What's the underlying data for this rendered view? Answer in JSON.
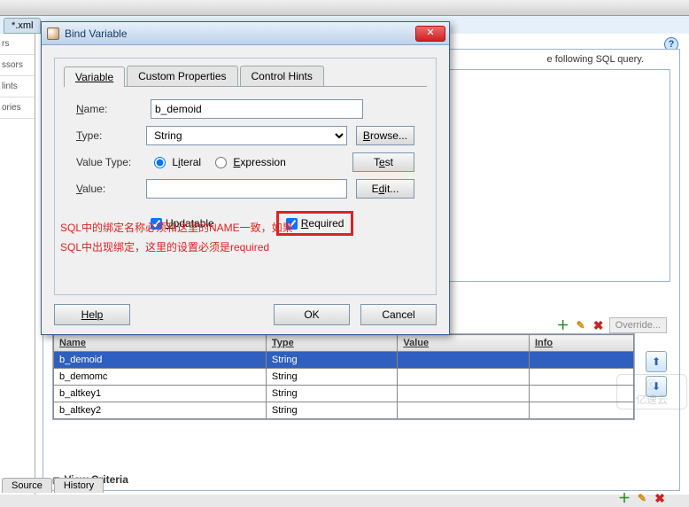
{
  "bg": {
    "tab": "*.xml",
    "left_items": [
      "rs",
      "ssors",
      "lints",
      "ories"
    ],
    "hint_text": "e following SQL query.",
    "override": "Override...",
    "section_title": "View Criteria",
    "bottom_tabs": [
      "Source",
      "History"
    ]
  },
  "dialog": {
    "title": "Bind Variable",
    "tabs": [
      "Variable",
      "Custom Properties",
      "Control Hints"
    ],
    "labels": {
      "name": "Name:",
      "type": "Type:",
      "value_type": "Value Type:",
      "value": "Value:"
    },
    "name_value": "b_demoid",
    "type_value": "String",
    "browse": "Browse...",
    "test": "Test",
    "edit": "Edit...",
    "literal": "Literal",
    "expression": "Expression",
    "updatable": "Updatable",
    "required": "Required",
    "note1": "SQL中的绑定名称必须和这里的NAME一致，如果",
    "note2": "SQL中出现绑定，这里的设置必须是required",
    "help": "Help",
    "ok": "OK",
    "cancel": "Cancel"
  },
  "table": {
    "headers": [
      "Name",
      "Type",
      "Value",
      "Info"
    ],
    "rows": [
      {
        "name": "b_demoid",
        "type": "String",
        "value": "",
        "info": "",
        "selected": true
      },
      {
        "name": "b_demomc",
        "type": "String",
        "value": "",
        "info": "",
        "selected": false
      },
      {
        "name": "b_altkey1",
        "type": "String",
        "value": "",
        "info": "",
        "selected": false
      },
      {
        "name": "b_altkey2",
        "type": "String",
        "value": "",
        "info": "",
        "selected": false
      }
    ]
  },
  "watermark": "亿速云"
}
